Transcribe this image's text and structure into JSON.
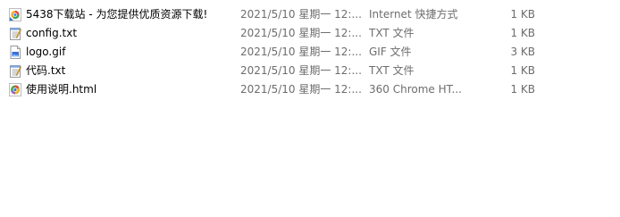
{
  "files": [
    {
      "name": "5438下载站 - 为您提供优质资源下载!",
      "date": "2021/5/10 星期一 12:...",
      "type": "Internet 快捷方式",
      "size": "1 KB",
      "icon": "internet-shortcut-icon"
    },
    {
      "name": "config.txt",
      "date": "2021/5/10 星期一 12:...",
      "type": "TXT 文件",
      "size": "1 KB",
      "icon": "text-file-icon"
    },
    {
      "name": "logo.gif",
      "date": "2021/5/10 星期一 12:...",
      "type": "GIF 文件",
      "size": "3 KB",
      "icon": "image-file-icon"
    },
    {
      "name": "代码.txt",
      "date": "2021/5/10 星期一 12:...",
      "type": "TXT 文件",
      "size": "1 KB",
      "icon": "text-file-icon"
    },
    {
      "name": "使用说明.html",
      "date": "2021/5/10 星期一 12:...",
      "type": "360 Chrome HT...",
      "size": "1 KB",
      "icon": "browser-html-icon"
    }
  ]
}
